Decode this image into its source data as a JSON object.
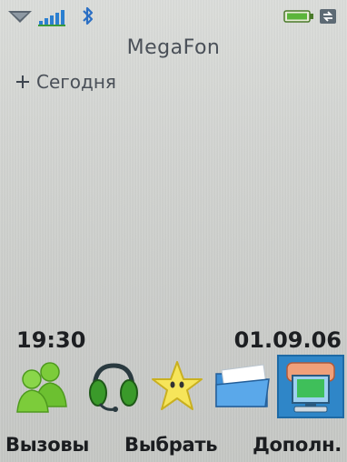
{
  "status_bar": {
    "icons": [
      "menu-arrow-icon",
      "signal-icon",
      "bluetooth-icon",
      "battery-icon",
      "sync-icon"
    ]
  },
  "operator": "MegaFon",
  "today": {
    "label": "Сегодня",
    "expand_icon": "plus-icon"
  },
  "clock": {
    "time": "19:30",
    "date": "01.09.06"
  },
  "dock": {
    "items": [
      {
        "name": "contacts",
        "icon": "people-icon"
      },
      {
        "name": "headset",
        "icon": "headset-icon"
      },
      {
        "name": "star",
        "icon": "star-icon"
      },
      {
        "name": "folder",
        "icon": "folder-icon"
      },
      {
        "name": "connectivity",
        "icon": "computer-icon",
        "selected": true
      }
    ]
  },
  "softkeys": {
    "left": "Вызовы",
    "center": "Выбрать",
    "right": "Дополн."
  },
  "colors": {
    "selected_bg": "#2f86c8",
    "text_dark": "#1d1f22",
    "operator_text": "#4a5058"
  }
}
